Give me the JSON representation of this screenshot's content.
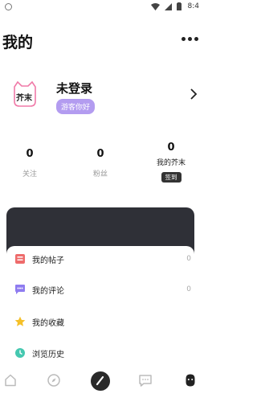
{
  "status_bar": {
    "time": "8:4"
  },
  "header": {
    "title": "我的"
  },
  "profile": {
    "avatar_logo_text": "芥末",
    "username": "未登录",
    "greeting": "游客你好"
  },
  "stats": [
    {
      "value": "0",
      "label": "关注"
    },
    {
      "value": "0",
      "label": "粉丝"
    },
    {
      "value": "0",
      "label": "我的芥末",
      "action": "签到"
    }
  ],
  "menu": [
    {
      "label": "我的帖子",
      "count": "0",
      "icon": "posts-icon",
      "color": "#ee6b6b"
    },
    {
      "label": "我的评论",
      "count": "0",
      "icon": "comment-icon",
      "color": "#8f7cf0"
    },
    {
      "label": "我的收藏",
      "icon": "star-icon",
      "color": "#f5c028"
    },
    {
      "label": "浏览历史",
      "icon": "history-icon",
      "color": "#45c8b0"
    }
  ],
  "tab_bar": [
    {
      "icon": "home-icon"
    },
    {
      "icon": "discover-icon"
    },
    {
      "icon": "post-icon"
    },
    {
      "icon": "message-icon"
    },
    {
      "icon": "profile-icon",
      "active": true
    }
  ],
  "colors": {
    "accent": "#b39cf0",
    "dark_card": "#2f3037"
  }
}
